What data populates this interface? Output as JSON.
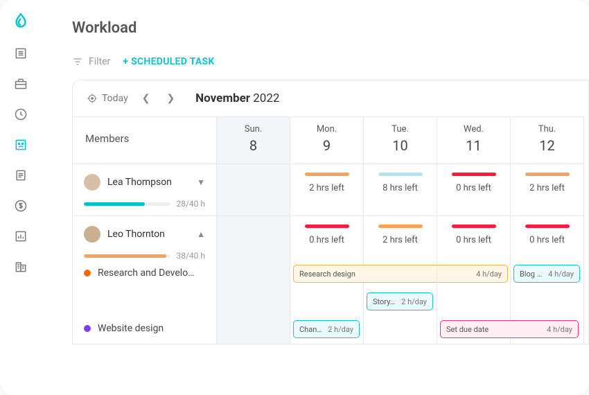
{
  "title": "Workload",
  "toolbar": {
    "filter": "Filter",
    "scheduled": "+ SCHEDULED TASK"
  },
  "dateNav": {
    "today": "Today",
    "monthBold": "November",
    "year": "2022"
  },
  "columns": {
    "members": "Members"
  },
  "days": [
    {
      "dow": "Sun.",
      "dom": "8",
      "muted": true
    },
    {
      "dow": "Mon.",
      "dom": "9"
    },
    {
      "dow": "Tue.",
      "dom": "10"
    },
    {
      "dow": "Wed.",
      "dom": "11"
    },
    {
      "dow": "Thu.",
      "dom": "12"
    }
  ],
  "members": [
    {
      "name": "Lea Thompson",
      "expanded": false,
      "hours": "28/40 h",
      "barColor": "#00c0d1",
      "barPct": 70,
      "cells": [
        {
          "muted": true
        },
        {
          "color": "#f8a25b",
          "text": "2 hrs left"
        },
        {
          "color": "#b8e3ec",
          "text": "8 hrs left"
        },
        {
          "color": "#ff1a3c",
          "text": "0 hrs left"
        },
        {
          "color": "#f8a25b",
          "text": "2 hrs left"
        }
      ]
    },
    {
      "name": "Leo Thornton",
      "expanded": true,
      "hours": "38/40 h",
      "barColor": "#f8a25b",
      "barPct": 95,
      "cells": [
        {
          "muted": true
        },
        {
          "color": "#ff1a3c",
          "text": "0 hrs left"
        },
        {
          "color": "#f8a25b",
          "text": "2 hrs left"
        },
        {
          "color": "#ff1a3c",
          "text": "0 hrs left"
        },
        {
          "color": "#ff1a3c",
          "text": "0 hrs left"
        }
      ],
      "projects": [
        {
          "name": "Research and Develo…",
          "color": "#ff6a00"
        },
        {
          "name": "Website design",
          "color": "#7b3ff2"
        }
      ]
    }
  ],
  "tasks": {
    "row1": {
      "research": {
        "label": "Research design",
        "hours": "4 h/day",
        "bg": "#fff7e6",
        "border": "#f5b544"
      },
      "blog": {
        "label": "Blog p…",
        "hours": "4 h/day",
        "bg": "#eaf9fc",
        "border": "#19c3d6"
      }
    },
    "row2": {
      "story": {
        "label": "Story…",
        "hours": "2 h/day",
        "bg": "#eaf9fc",
        "border": "#19c3d6"
      }
    },
    "row3": {
      "chang": {
        "label": "Chang…",
        "hours": "2 h/day",
        "bg": "#eaf9fc",
        "border": "#19c3d6"
      },
      "due": {
        "label": "Set due date",
        "hours": "4 h/day",
        "bg": "#ffeef4",
        "border": "#ff2e7e"
      }
    }
  },
  "colors": {
    "accent": "#00c0d1"
  }
}
